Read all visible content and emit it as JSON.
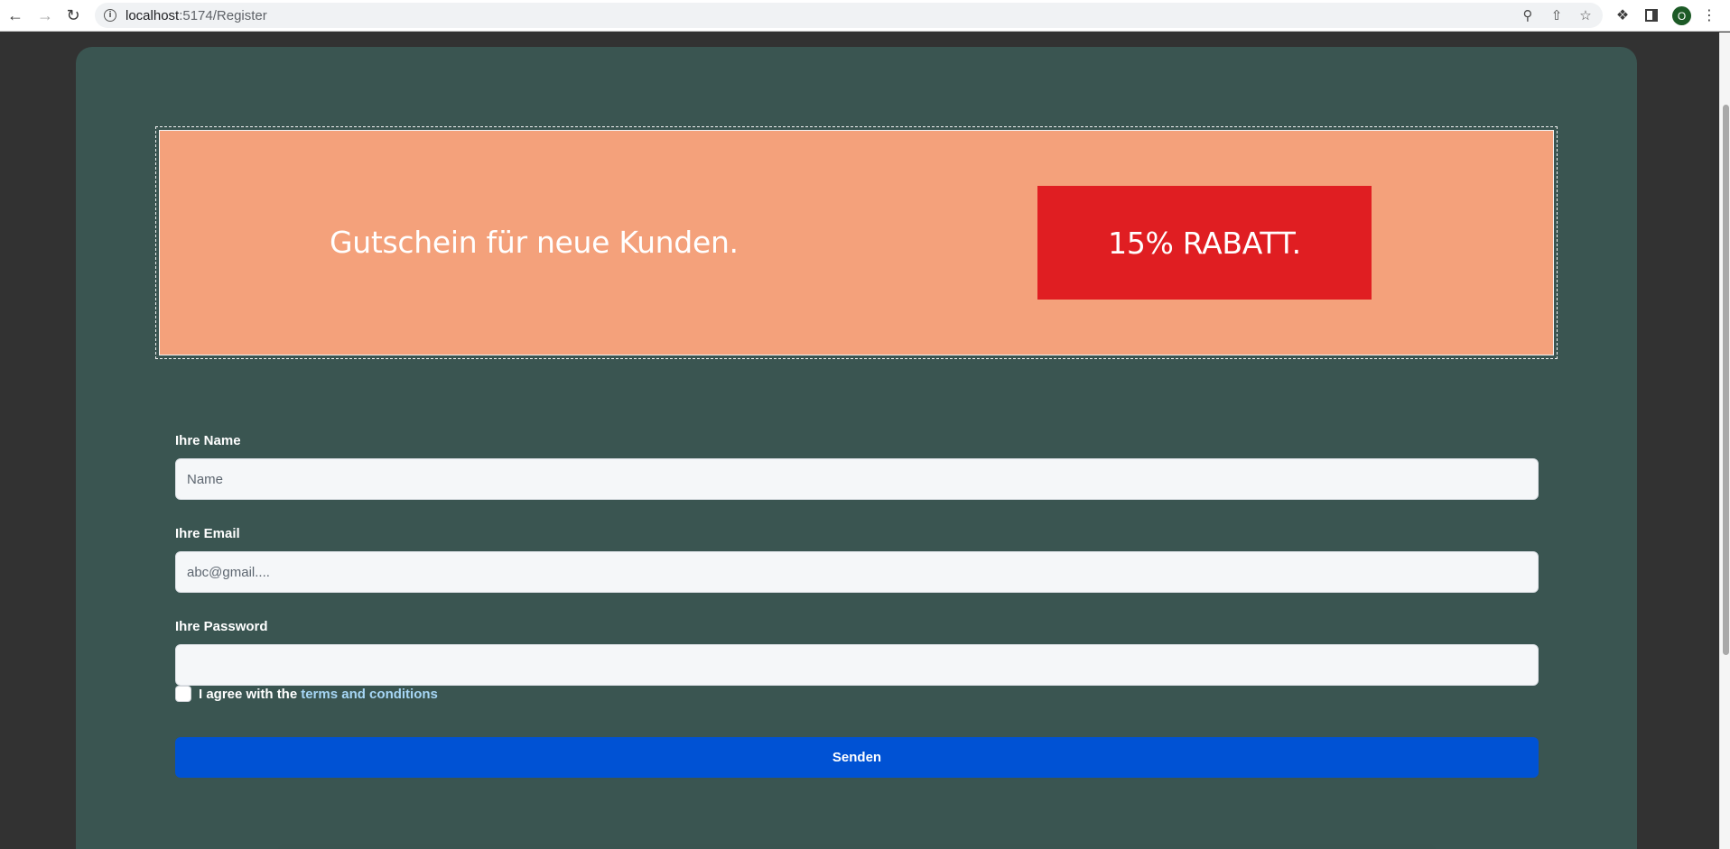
{
  "browser": {
    "url_host": "localhost",
    "url_path": ":5174/Register",
    "avatar_letter": "O",
    "icons": [
      "back-arrow-icon",
      "forward-arrow-icon",
      "reload-icon",
      "info-icon",
      "zoom-icon",
      "share-icon",
      "bookmark-star-icon",
      "extensions-icon",
      "side-panel-icon",
      "kebab-menu-icon"
    ]
  },
  "promo": {
    "text": "Gutschein für neue Kunden.",
    "badge": "15% RABATT."
  },
  "form": {
    "name": {
      "label": "Ihre Name",
      "placeholder": "Name",
      "value": ""
    },
    "email": {
      "label": "Ihre Email",
      "placeholder": "abc@gmail....",
      "value": ""
    },
    "password": {
      "label": "Ihre Password",
      "placeholder": "",
      "value": ""
    },
    "agree_text": "I agree with the",
    "terms_link": "terms and conditions",
    "agree_checked": false,
    "submit_label": "Senden"
  },
  "colors": {
    "card": "#3a5551",
    "promo_bg": "#f4a17b",
    "badge_bg": "#e01e22",
    "submit_bg": "#0052d4",
    "link": "#a6d6f5"
  }
}
